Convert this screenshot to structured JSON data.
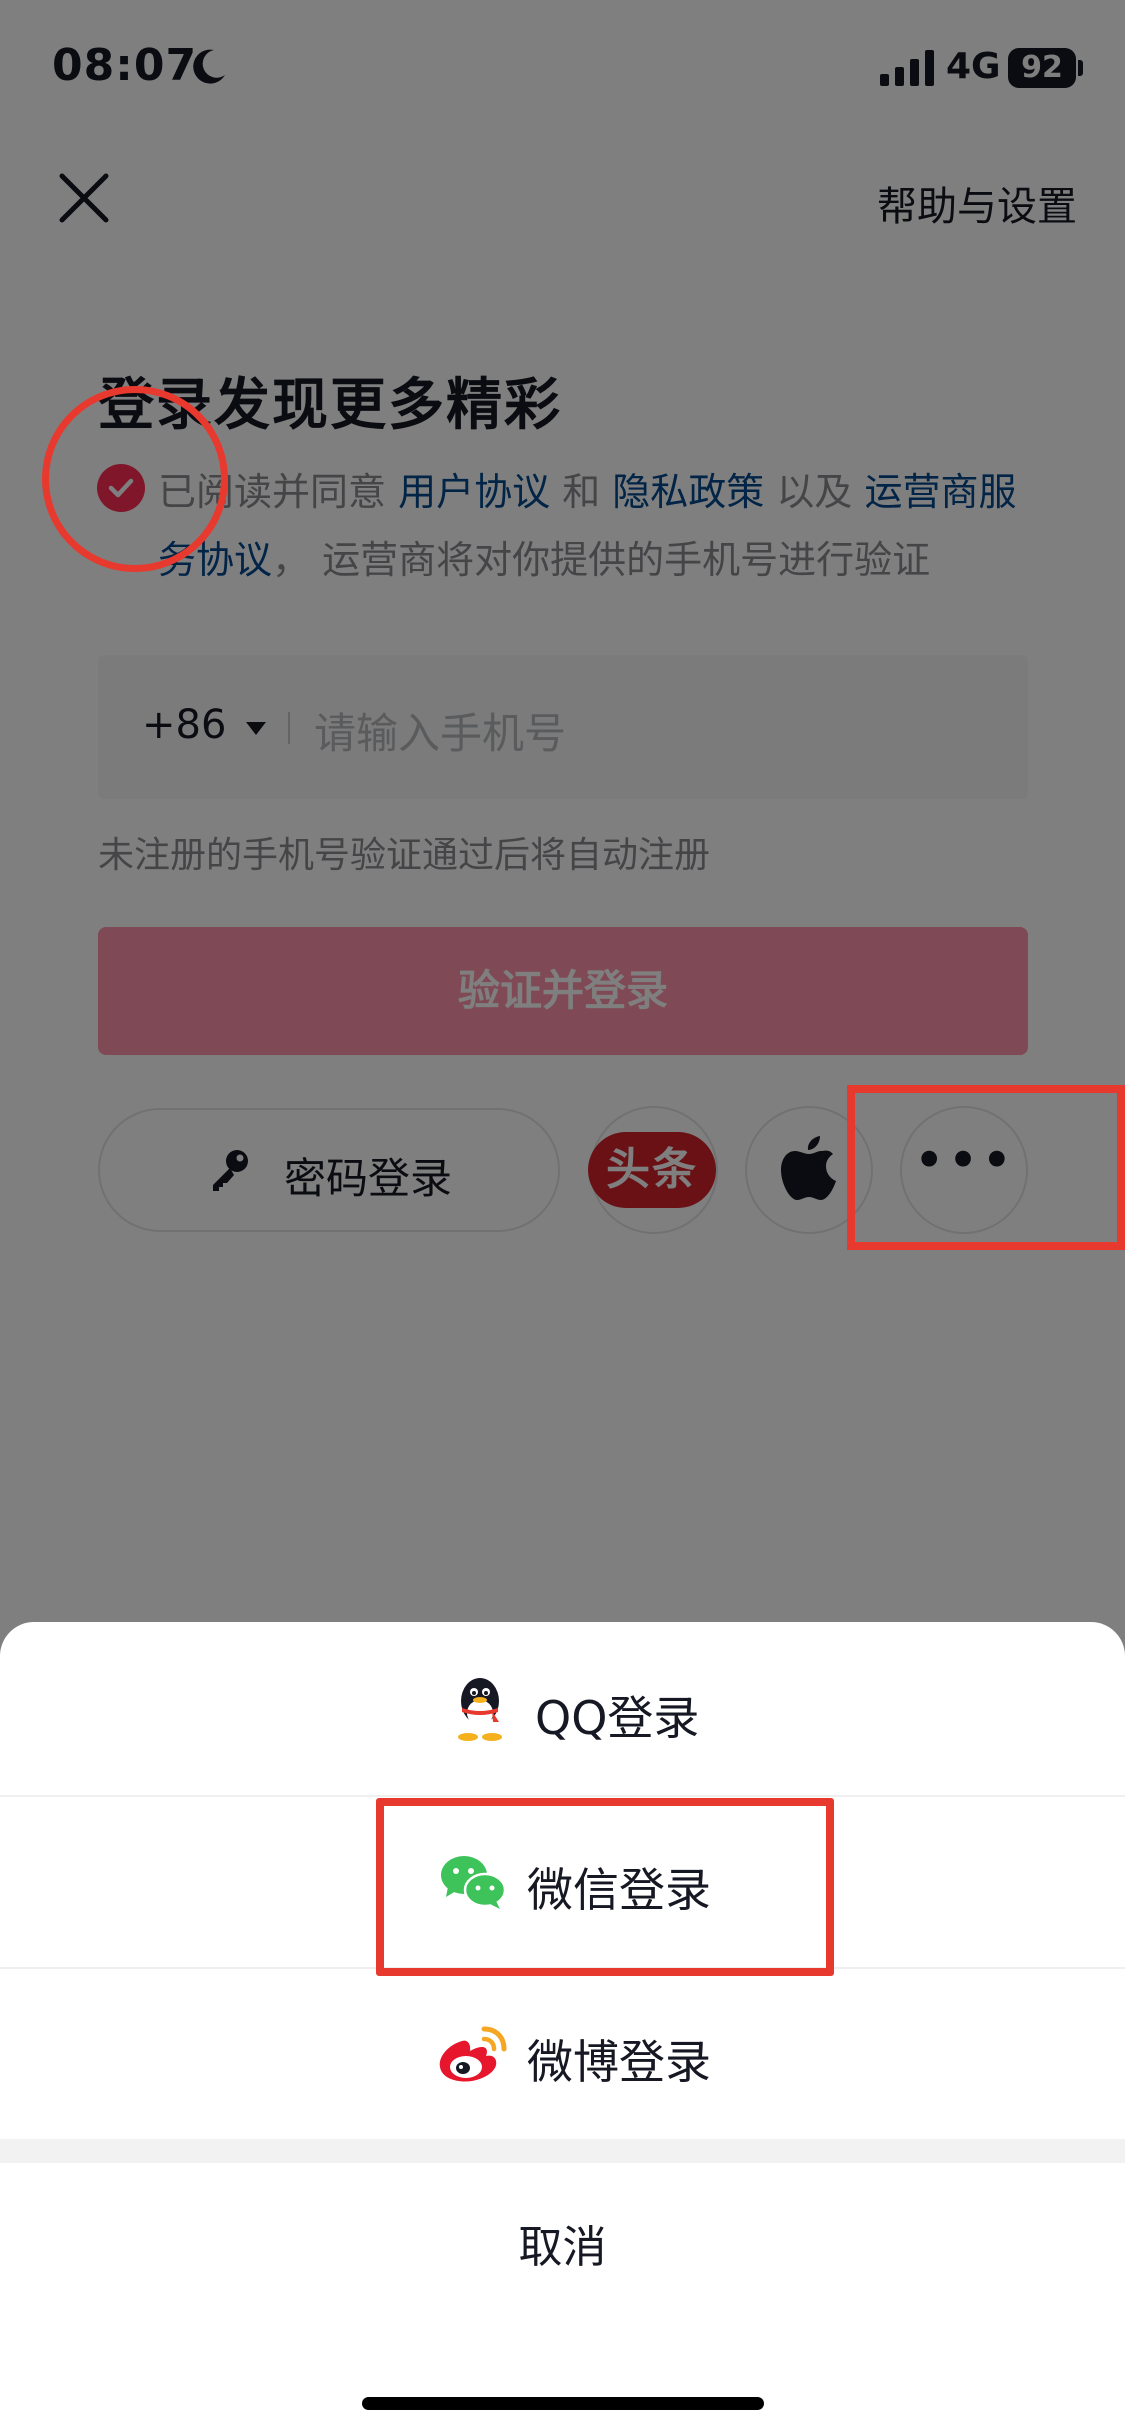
{
  "status_bar": {
    "time": "08:07",
    "network": "4G",
    "battery": "92"
  },
  "header": {
    "help_label": "帮助与设置"
  },
  "login": {
    "title": "登录发现更多精彩",
    "agreement": {
      "part1": "已阅读并同意 ",
      "user_agreement": "用户协议",
      "part2": " 和 ",
      "privacy_policy": "隐私政策",
      "part3": " 以及 ",
      "carrier_agreement": "运营商服务协议",
      "part4": "， 运营商将对你提供的手机号进行验证",
      "checked": true
    },
    "country_code": "+86",
    "phone_placeholder": "请输入手机号",
    "hint": "未注册的手机号验证通过后将自动注册",
    "submit_label": "验证并登录",
    "password_login_label": "密码登录",
    "toutiao_label": "头条",
    "more_label": "•••"
  },
  "sheet": {
    "options": [
      {
        "label": "QQ登录",
        "icon": "qq-icon"
      },
      {
        "label": "微信登录",
        "icon": "wechat-icon"
      },
      {
        "label": "微博登录",
        "icon": "weibo-icon"
      }
    ],
    "cancel_label": "取消"
  },
  "colors": {
    "accent": "#fe2c55",
    "link": "#04498d",
    "annotation": "#e8392e",
    "wechat": "#3ec25a"
  }
}
